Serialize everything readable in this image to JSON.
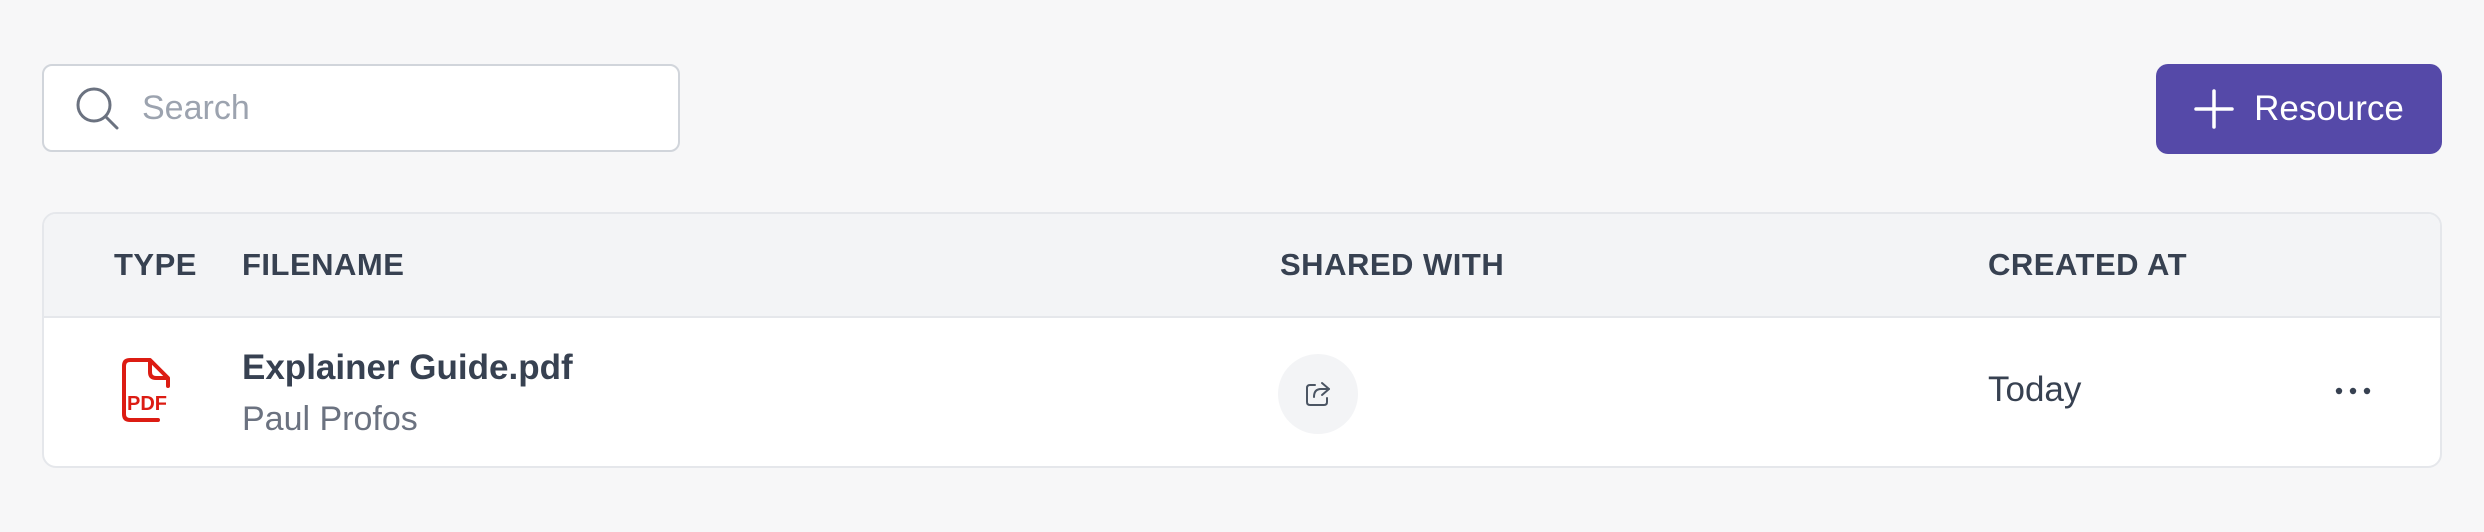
{
  "search": {
    "placeholder": "Search",
    "value": ""
  },
  "toolbar": {
    "add_label": "Resource"
  },
  "table": {
    "columns": {
      "type": "TYPE",
      "filename": "FILENAME",
      "shared_with": "SHARED WITH",
      "created_at": "CREATED AT"
    },
    "rows": [
      {
        "type_icon": "pdf-icon",
        "filename": "Explainer Guide.pdf",
        "owner": "Paul Profos",
        "shared_icon": "share-icon",
        "created_at": "Today"
      }
    ]
  },
  "colors": {
    "accent": "#5549a8",
    "pdf_red": "#dc1c13",
    "background": "#f7f7f8",
    "header_bg": "#f3f4f6"
  }
}
